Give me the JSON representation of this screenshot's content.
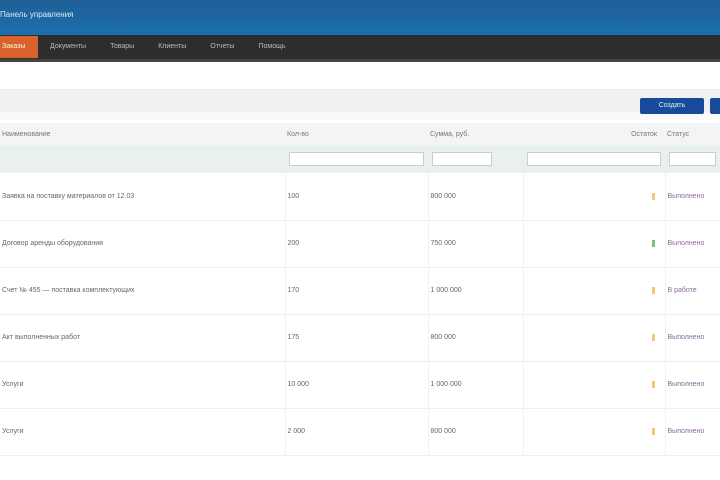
{
  "header": {
    "title": "Панель управления"
  },
  "nav": {
    "items": [
      "Заказы",
      "Документы",
      "Товары",
      "Клиенты",
      "Отчеты",
      "Помощь"
    ]
  },
  "toolbar": {
    "create_label": "Создать",
    "second_label": ""
  },
  "table": {
    "columns": [
      "Наименование",
      "Кол-во",
      "Сумма, руб.",
      "Остаток",
      "Статус"
    ],
    "rows": [
      {
        "name": "Заявка на поставку материалов от 12.03",
        "qty": "100",
        "sum": "800 000",
        "mark": "#f5c77a",
        "status": "Выполнено"
      },
      {
        "name": "Договор аренды оборудования",
        "qty": "200",
        "sum": "750 000",
        "mark": "#7cbf7c",
        "status": "Выполнено"
      },
      {
        "name": "Счет № 455 — поставка комплектующих",
        "qty": "170",
        "sum": "1 000 000",
        "mark": "#f5c77a",
        "status": "В работе"
      },
      {
        "name": "Акт выполненных работ",
        "qty": "175",
        "sum": "800 000",
        "mark": "#f5c77a",
        "status": "Выполнено"
      },
      {
        "name": "Услуги",
        "qty": "10 000",
        "sum": "1 000 000",
        "mark": "#f5c77a",
        "status": "Выполнено"
      },
      {
        "name": "Услуги",
        "qty": "2 000",
        "sum": "800 000",
        "mark": "#f5c77a",
        "status": "Выполнено"
      }
    ]
  }
}
